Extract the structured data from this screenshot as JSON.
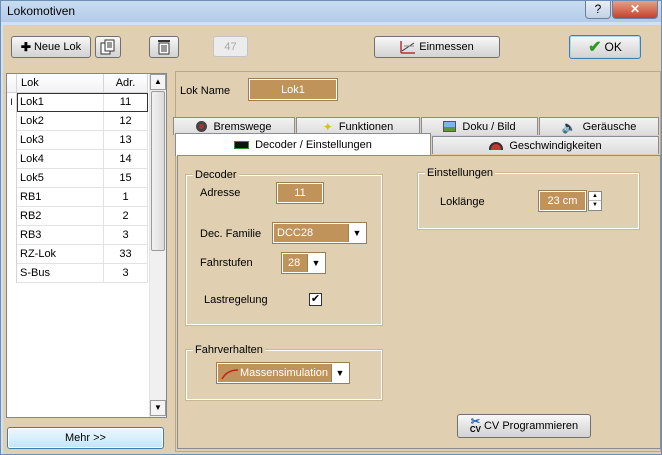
{
  "window": {
    "title": "Lokomotiven",
    "help_label": "?",
    "close_label": "✕"
  },
  "toolbar": {
    "new_lok_label": "Neue Lok",
    "disabled_label": "47",
    "measure_label": "Einmessen",
    "ok_label": "OK"
  },
  "list": {
    "col_name": "Lok",
    "col_addr": "Adr.",
    "rows": [
      {
        "name": "Lok1",
        "addr": "11"
      },
      {
        "name": "Lok2",
        "addr": "12"
      },
      {
        "name": "Lok3",
        "addr": "13"
      },
      {
        "name": "Lok4",
        "addr": "14"
      },
      {
        "name": "Lok5",
        "addr": "15"
      },
      {
        "name": "RB1",
        "addr": "1"
      },
      {
        "name": "RB2",
        "addr": "2"
      },
      {
        "name": "RB3",
        "addr": "3"
      },
      {
        "name": "RZ-Lok",
        "addr": "33"
      },
      {
        "name": "S-Bus",
        "addr": "3"
      }
    ],
    "more_label": "Mehr >>"
  },
  "lok": {
    "name_label": "Lok Name",
    "name_value": "Lok1"
  },
  "tabs": {
    "bremswege": "Bremswege",
    "funktionen": "Funktionen",
    "doku": "Doku / Bild",
    "geraeusche": "Geräusche",
    "decoder": "Decoder / Einstellungen",
    "geschwindigkeiten": "Geschwindigkeiten"
  },
  "decoder": {
    "group_title": "Decoder",
    "adresse_label": "Adresse",
    "adresse_value": "11",
    "familie_label": "Dec. Familie",
    "familie_value": "DCC28",
    "fahrstufen_label": "Fahrstufen",
    "fahrstufen_value": "28",
    "lastregelung_label": "Lastregelung",
    "lastregelung_checked": "✔"
  },
  "einstellungen": {
    "group_title": "Einstellungen",
    "loklaenge_label": "Loklänge",
    "loklaenge_value": "23 cm"
  },
  "fahrverhalten": {
    "group_title": "Fahrverhalten",
    "value": "Massensimulation"
  },
  "cv": {
    "button_label": "CV Programmieren",
    "icon_text": "CV"
  },
  "colors": {
    "field_bg": "#c0935a",
    "panel_bg": "#e0cfb0",
    "ok_check": "#2d9a22"
  }
}
